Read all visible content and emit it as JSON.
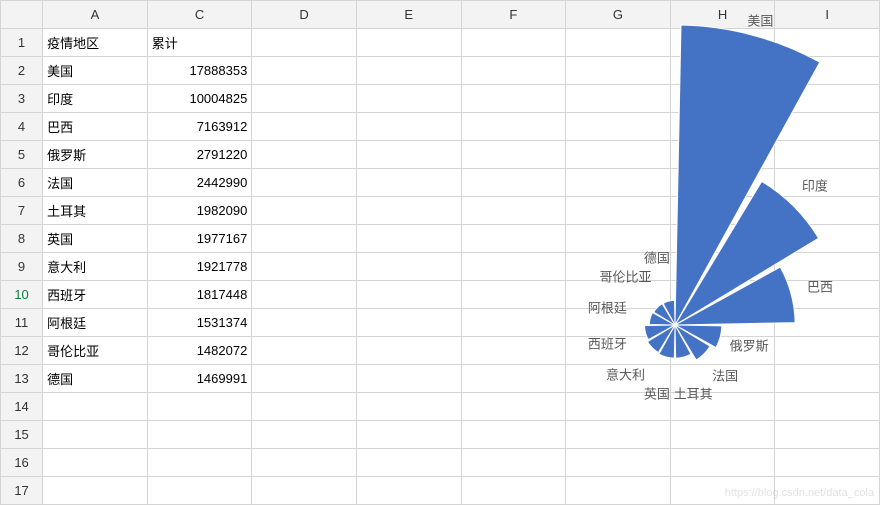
{
  "columns": [
    "A",
    "C",
    "D",
    "E",
    "F",
    "G",
    "H",
    "I"
  ],
  "row_headers": [
    "1",
    "2",
    "3",
    "4",
    "5",
    "6",
    "7",
    "8",
    "9",
    "10",
    "11",
    "12",
    "13",
    "14",
    "15",
    "16",
    "17"
  ],
  "selected_row_index": 9,
  "table": {
    "headers": {
      "region": "疫情地区",
      "total": "累计"
    },
    "rows": [
      {
        "region": "美国",
        "total": "17888353"
      },
      {
        "region": "印度",
        "total": "10004825"
      },
      {
        "region": "巴西",
        "total": "7163912"
      },
      {
        "region": "俄罗斯",
        "total": "2791220"
      },
      {
        "region": "法国",
        "total": "2442990"
      },
      {
        "region": "土耳其",
        "total": "1982090"
      },
      {
        "region": "英国",
        "total": "1977167"
      },
      {
        "region": "意大利",
        "total": "1921778"
      },
      {
        "region": "西班牙",
        "total": "1817448"
      },
      {
        "region": "阿根廷",
        "total": "1531374"
      },
      {
        "region": "哥伦比亚",
        "total": "1482072"
      },
      {
        "region": "德国",
        "total": "1469991"
      }
    ]
  },
  "chart_data": {
    "type": "pie",
    "subtype": "rose",
    "title": "",
    "series": [
      {
        "name": "累计",
        "categories": [
          "美国",
          "印度",
          "巴西",
          "俄罗斯",
          "法国",
          "土耳其",
          "英国",
          "意大利",
          "西班牙",
          "阿根廷",
          "哥伦比亚",
          "德国"
        ],
        "values": [
          17888353,
          10004825,
          7163912,
          2791220,
          2442990,
          1982090,
          1977167,
          1921778,
          1817448,
          1531374,
          1482072,
          1469991
        ]
      }
    ],
    "fill_color": "#4472c4",
    "legend": false
  },
  "watermark": "https://blog.csdn.net/data_cola"
}
